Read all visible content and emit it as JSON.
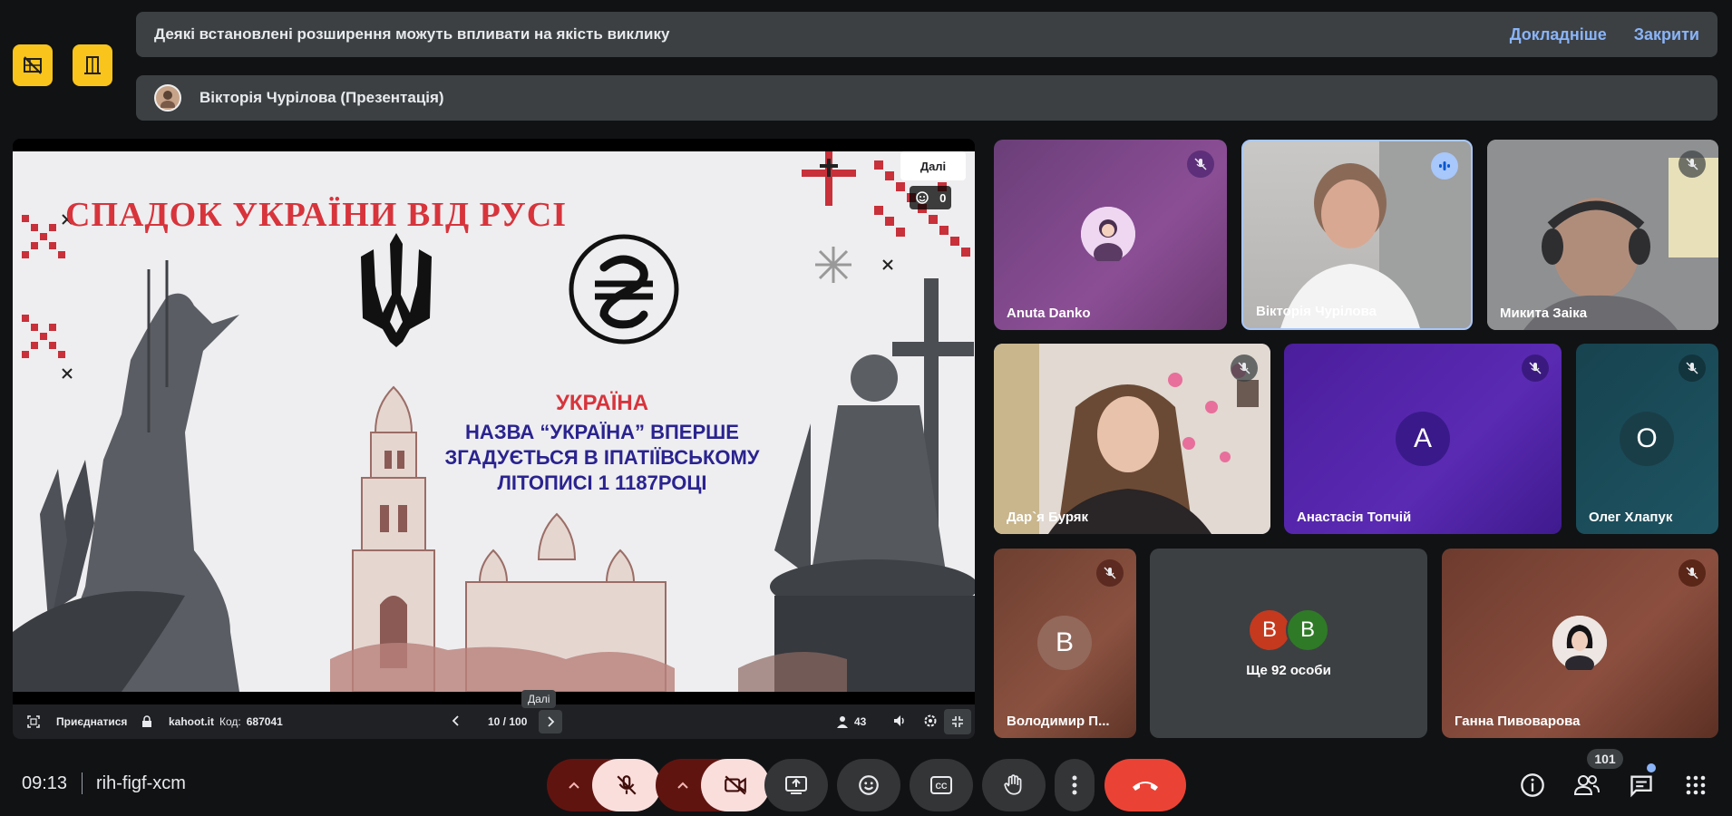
{
  "banner": {
    "message": "Деякі встановлені розширення можуть впливати на якість виклику",
    "more_label": "Докладніше",
    "close_label": "Закрити"
  },
  "presenter": {
    "label": "Вікторія Чурілова (Презентація)"
  },
  "slide": {
    "title": "СПАДОК УКРАЇНИ ВІД РУСІ",
    "heading": "УКРАЇНА",
    "text": "НАЗВА “УКРАЇНА” ВПЕРШЕ ЗГАДУЄТЬСЯ В ІПАТІЇВСЬКОМУ ЛІТОПИСІ 1 1187РОЦІ",
    "next_popup": "Далі",
    "reactions_count": "0"
  },
  "kahoot_bar": {
    "join_label": "Приєднатися",
    "site": "kahoot.it",
    "code_label": "Код:",
    "code_value": "687041",
    "page": "10 / 100",
    "players": "43",
    "tooltip": "Далі"
  },
  "participants": [
    {
      "name": "Anuta Danko",
      "muted": true
    },
    {
      "name": "Вікторія Чурілова",
      "speaking": true
    },
    {
      "name": "Микита Заіка",
      "muted": true
    },
    {
      "name": "Дар`я Буряк",
      "muted": true
    },
    {
      "name": "Анастасія Топчій",
      "initial": "А",
      "muted": true
    },
    {
      "name": "Олег Хлапук",
      "initial": "О",
      "muted": true
    },
    {
      "name": "Володимир П...",
      "initial": "В",
      "muted": true
    },
    {
      "name": "Ще 92 особи",
      "initials": [
        "В",
        "В"
      ]
    },
    {
      "name": "Ганна Пивоварова",
      "muted": true
    }
  ],
  "bottom": {
    "time": "09:13",
    "meeting_code": "rih-figf-xcm",
    "people_count": "101"
  },
  "colors": {
    "accent_blue": "#8ab4f8",
    "hangup_red": "#ea4335",
    "badge_yellow": "#f9c41c",
    "muted_red_bg": "#f9dedc"
  }
}
